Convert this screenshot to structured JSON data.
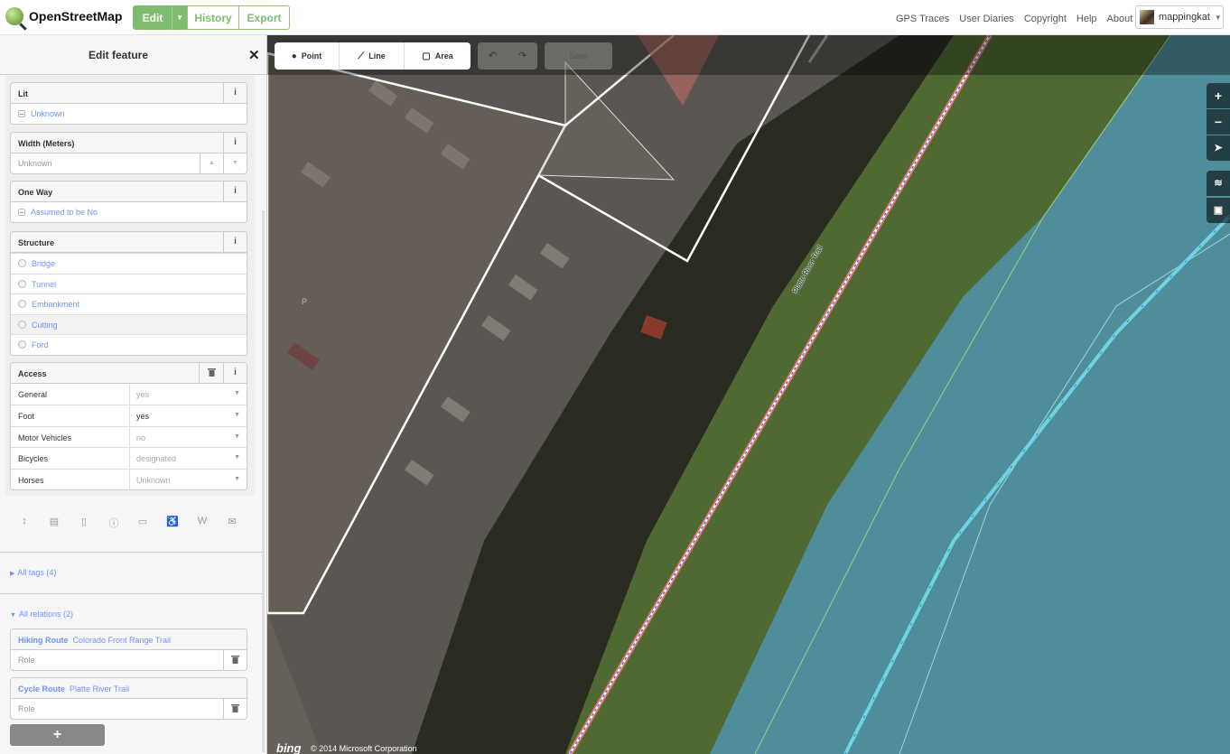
{
  "topbar": {
    "logo_text": "OpenStreetMap",
    "edit_label": "Edit",
    "history_label": "History",
    "export_label": "Export",
    "links": [
      "GPS Traces",
      "User Diaries",
      "Copyright",
      "Help",
      "About"
    ],
    "username": "mappingkat"
  },
  "sidebar": {
    "title": "Edit feature",
    "fields": {
      "lit": {
        "label": "Lit",
        "value": "Unknown"
      },
      "width": {
        "label": "Width (Meters)",
        "placeholder": "Unknown"
      },
      "oneway": {
        "label": "One Way",
        "value": "Assumed to be No"
      },
      "structure": {
        "label": "Structure",
        "options": [
          "Bridge",
          "Tunnel",
          "Embankment",
          "Cutting",
          "Ford"
        ]
      },
      "access": {
        "label": "Access",
        "rows": [
          {
            "key": "General",
            "value": "yes"
          },
          {
            "key": "Foot",
            "value": "yes"
          },
          {
            "key": "Motor Vehicles",
            "value": "no"
          },
          {
            "key": "Bicycles",
            "value": "designated"
          },
          {
            "key": "Horses",
            "value": "Unknown"
          }
        ]
      }
    },
    "all_tags": "All tags (4)",
    "all_relations": "All relations (2)",
    "relations": [
      {
        "type": "Hiking Route",
        "name": "Colorado Front Range Trail",
        "role_placeholder": "Role"
      },
      {
        "type": "Cycle Route",
        "name": "Platte River Trail",
        "role_placeholder": "Role"
      }
    ],
    "add_label": "+"
  },
  "map": {
    "modes": [
      "Point",
      "Line",
      "Area"
    ],
    "save_label": "Save",
    "trail_name": "Platte River Trail",
    "parking_symbol": "P",
    "imagery_brand": "bing",
    "copyright": "© 2014 Microsoft Corporation"
  },
  "colors": {
    "osm_green": "#7ebc6f",
    "link_blue": "#7092ff",
    "river_area": "#5aa6b8",
    "trail_red": "#e06e5f"
  }
}
